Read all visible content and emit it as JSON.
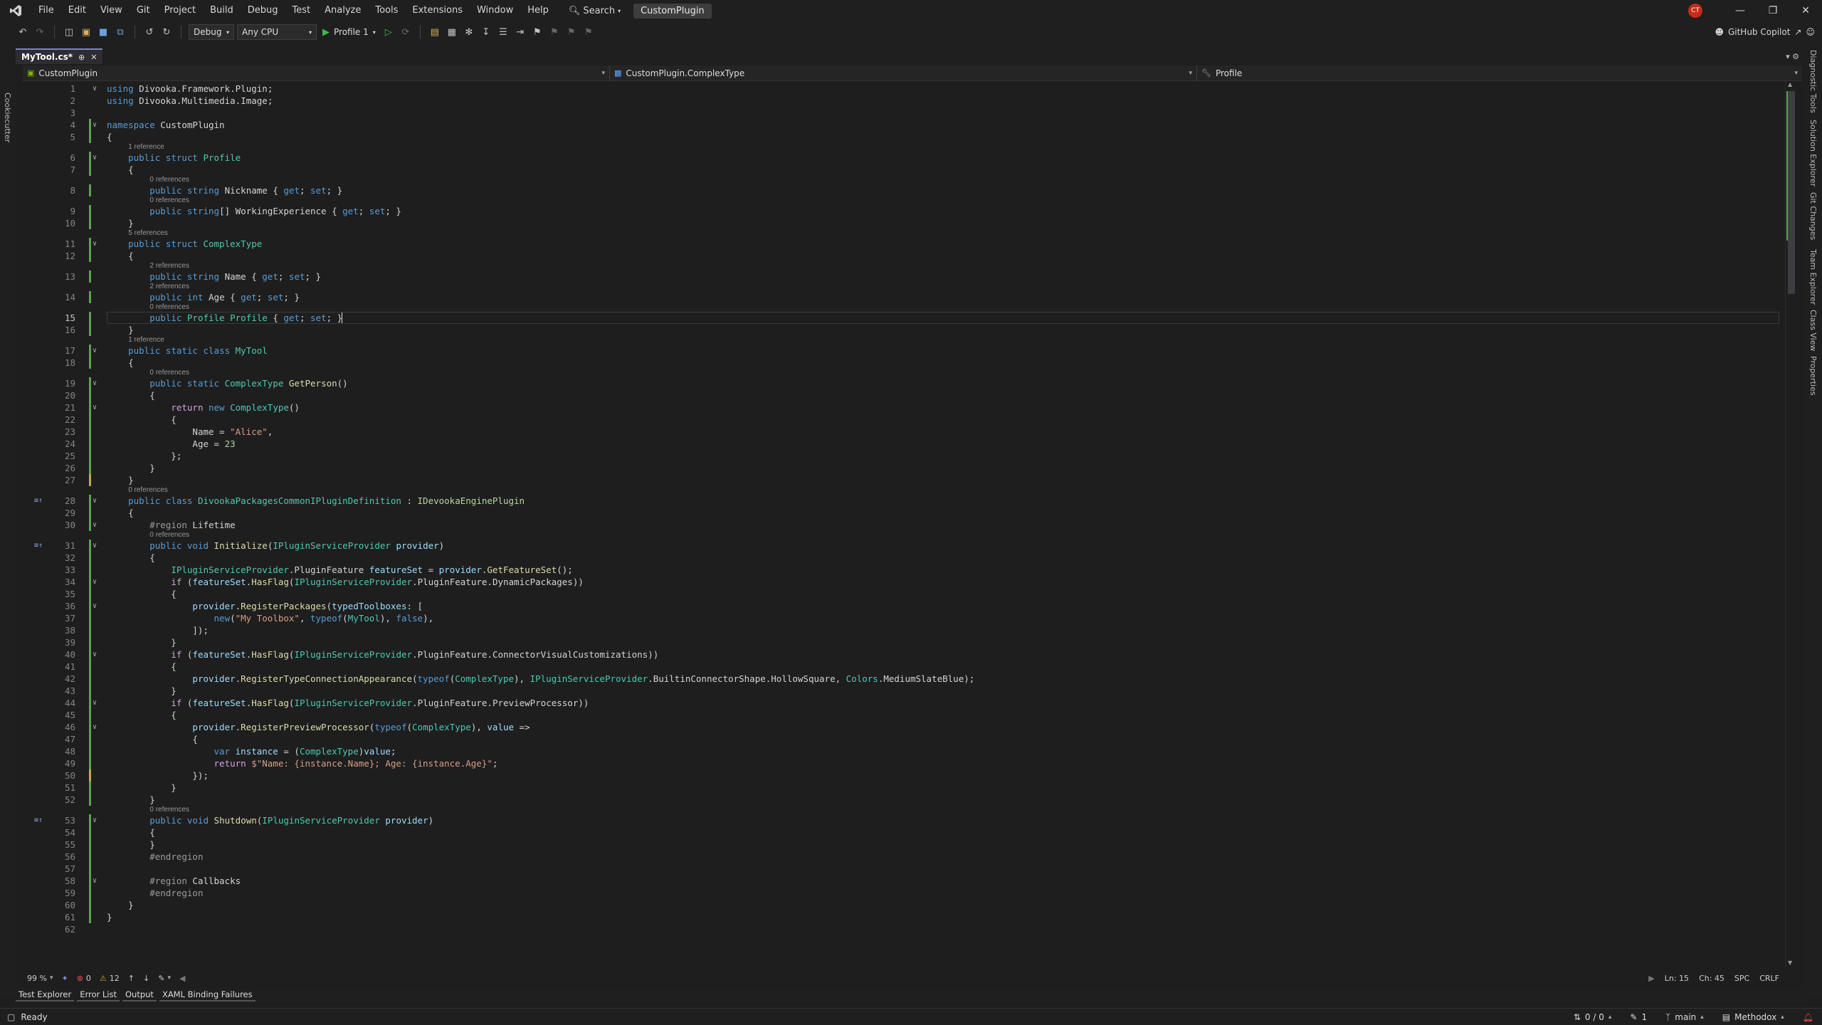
{
  "menu": [
    "File",
    "Edit",
    "View",
    "Git",
    "Project",
    "Build",
    "Debug",
    "Test",
    "Analyze",
    "Tools",
    "Extensions",
    "Window",
    "Help"
  ],
  "search_label": "Search",
  "solution_name": "CustomPlugin",
  "user_initials": "CT",
  "toolbar": {
    "config": "Debug",
    "platform": "Any CPU",
    "run_profile": "Profile 1",
    "copilot": "GitHub Copilot"
  },
  "left_rail_tab": "Cookiecutter",
  "right_rail_tabs": [
    "Diagnostic Tools",
    "Solution Explorer",
    "Git Changes",
    "Team Explorer",
    "Class View",
    "Properties"
  ],
  "document_tab": "MyTool.cs*",
  "navbar": {
    "project": "CustomPlugin",
    "type": "CustomPlugin.ComplexType",
    "member": "Profile"
  },
  "editor": {
    "current_line": 15,
    "lines": [
      {
        "n": 1,
        "t": "using Divooka.Framework.Plugin;"
      },
      {
        "n": 2,
        "t": "using Divooka.Multimedia.Image;"
      },
      {
        "n": 3,
        "t": ""
      },
      {
        "n": 4,
        "t": "namespace CustomPlugin"
      },
      {
        "n": 5,
        "t": "{"
      },
      {
        "n": 6,
        "t": "    public struct Profile",
        "lens": "1 reference"
      },
      {
        "n": 7,
        "t": "    {"
      },
      {
        "n": 8,
        "t": "        public string Nickname { get; set; }",
        "lens": "0 references"
      },
      {
        "n": 9,
        "t": "        public string[] WorkingExperience { get; set; }",
        "lens": "0 references"
      },
      {
        "n": 10,
        "t": "    }"
      },
      {
        "n": 11,
        "t": "    public struct ComplexType",
        "lens": "5 references"
      },
      {
        "n": 12,
        "t": "    {"
      },
      {
        "n": 13,
        "t": "        public string Name { get; set; }",
        "lens": "2 references"
      },
      {
        "n": 14,
        "t": "        public int Age { get; set; }",
        "lens": "2 references"
      },
      {
        "n": 15,
        "t": "        public Profile Profile { get; set; }",
        "lens": "0 references"
      },
      {
        "n": 16,
        "t": "    }"
      },
      {
        "n": 17,
        "t": "    public static class MyTool",
        "lens": "1 reference"
      },
      {
        "n": 18,
        "t": "    {"
      },
      {
        "n": 19,
        "t": "        public static ComplexType GetPerson()",
        "lens": "0 references"
      },
      {
        "n": 20,
        "t": "        {"
      },
      {
        "n": 21,
        "t": "            return new ComplexType()"
      },
      {
        "n": 22,
        "t": "            {"
      },
      {
        "n": 23,
        "t": "                Name = \"Alice\","
      },
      {
        "n": 24,
        "t": "                Age = 23"
      },
      {
        "n": 25,
        "t": "            };"
      },
      {
        "n": 26,
        "t": "        }"
      },
      {
        "n": 27,
        "t": "    }"
      },
      {
        "n": 28,
        "t": "    public class DivookaPackagesCommonIPluginDefinition : IDevookaEnginePlugin",
        "lens": "0 references"
      },
      {
        "n": 29,
        "t": "    {"
      },
      {
        "n": 30,
        "t": "        #region Lifetime"
      },
      {
        "n": 31,
        "t": "        public void Initialize(IPluginServiceProvider provider)",
        "lens": "0 references"
      },
      {
        "n": 32,
        "t": "        {"
      },
      {
        "n": 33,
        "t": "            IPluginServiceProvider.PluginFeature featureSet = provider.GetFeatureSet();"
      },
      {
        "n": 34,
        "t": "            if (featureSet.HasFlag(IPluginServiceProvider.PluginFeature.DynamicPackages))"
      },
      {
        "n": 35,
        "t": "            {"
      },
      {
        "n": 36,
        "t": "                provider.RegisterPackages(typedToolboxes: ["
      },
      {
        "n": 37,
        "t": "                    new(\"My Toolbox\", typeof(MyTool), false),"
      },
      {
        "n": 38,
        "t": "                ]);"
      },
      {
        "n": 39,
        "t": "            }"
      },
      {
        "n": 40,
        "t": "            if (featureSet.HasFlag(IPluginServiceProvider.PluginFeature.ConnectorVisualCustomizations))"
      },
      {
        "n": 41,
        "t": "            {"
      },
      {
        "n": 42,
        "t": "                provider.RegisterTypeConnectionAppearance(typeof(ComplexType), IPluginServiceProvider.BuiltinConnectorShape.HollowSquare, Colors.MediumSlateBlue);"
      },
      {
        "n": 43,
        "t": "            }"
      },
      {
        "n": 44,
        "t": "            if (featureSet.HasFlag(IPluginServiceProvider.PluginFeature.PreviewProcessor))"
      },
      {
        "n": 45,
        "t": "            {"
      },
      {
        "n": 46,
        "t": "                provider.RegisterPreviewProcessor(typeof(ComplexType), value =>"
      },
      {
        "n": 47,
        "t": "                {"
      },
      {
        "n": 48,
        "t": "                    var instance = (ComplexType)value;"
      },
      {
        "n": 49,
        "t": "                    return $\"Name: {instance.Name}; Age: {instance.Age}\";"
      },
      {
        "n": 50,
        "t": "                });"
      },
      {
        "n": 51,
        "t": "            }"
      },
      {
        "n": 52,
        "t": "        }"
      },
      {
        "n": 53,
        "t": "        public void Shutdown(IPluginServiceProvider provider)",
        "lens": "0 references"
      },
      {
        "n": 54,
        "t": "        {"
      },
      {
        "n": 55,
        "t": "        }"
      },
      {
        "n": 56,
        "t": "        #endregion"
      },
      {
        "n": 57,
        "t": ""
      },
      {
        "n": 58,
        "t": "        #region Callbacks"
      },
      {
        "n": 59,
        "t": "        #endregion"
      },
      {
        "n": 60,
        "t": "    }"
      },
      {
        "n": 61,
        "t": "}"
      },
      {
        "n": 62,
        "t": ""
      }
    ]
  },
  "editor_status": {
    "zoom": "99 %",
    "errors": "0",
    "warnings": "12",
    "ln": "Ln: 15",
    "ch": "Ch: 45",
    "spc": "SPC",
    "crlf": "CRLF"
  },
  "tool_tabs": [
    "Test Explorer",
    "Error List",
    "Output",
    "XAML Binding Failures"
  ],
  "statusbar": {
    "ready": "Ready",
    "sync": "0 / 0",
    "edits": "1",
    "branch": "main",
    "repo": "Methodox"
  }
}
